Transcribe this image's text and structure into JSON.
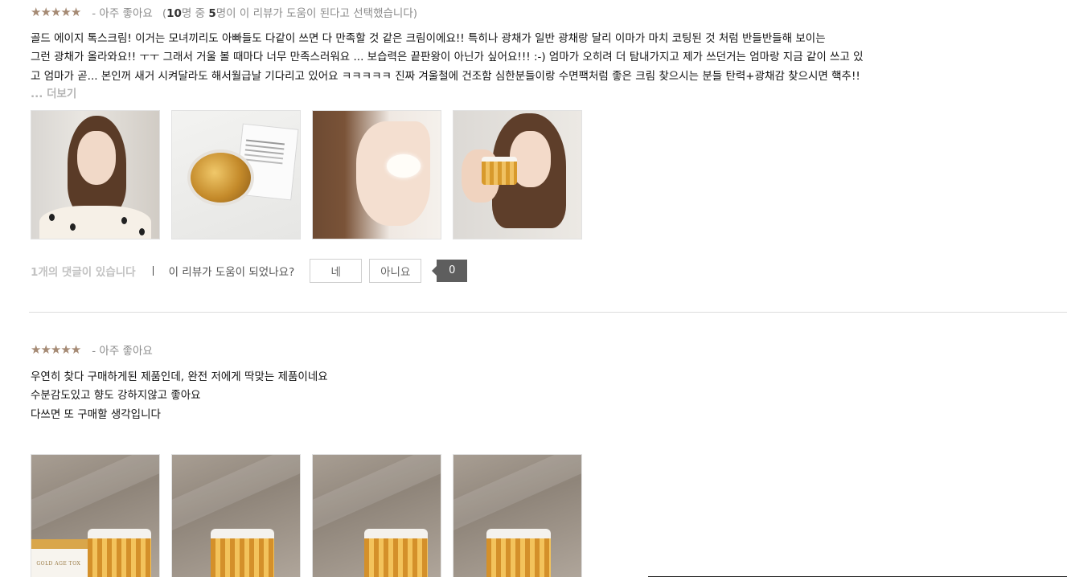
{
  "reviews": [
    {
      "rating": 5,
      "rating_label": "- 아주 좋아요",
      "helpful_summary": {
        "prefix": "(",
        "total": "10",
        "mid1": "명 중 ",
        "helpful": "5",
        "suffix": "명이 이 리뷰가 도움이 된다고 선택했습니다)"
      },
      "body_lines": [
        "골드 에이지 톡스크림! 이거는 모녀끼리도 아빠들도 다같이 쓰면 다 만족할 것 같은 크림이에요!! 특히나 광채가 일반 광채랑 달리 이마가 마치 코팅된 것 처럼 반들반들해 보이는",
        "그런 광채가 올라와요!! ㅜㅜ 그래서 거울 볼 때마다 너무 만족스러워요 ... 보습력은 끝판왕이 아닌가 싶어요!!! :-) 엄마가 오히려 더 탐내가지고 제가 쓰던거는 엄마랑 지금 같이 쓰고 있",
        "고 엄마가 곧... 본인꺼 새거 시켜달라도 해서월급날 기다리고 있어요 ㅋㅋㅋㅋㅋ 진짜 겨울철에 건조함 심한분들이랑 수면팩처럼 좋은 크림 찾으시는 분들 탄력+광채감 찾으시면 핵추!!"
      ],
      "more_label": "... 더보기",
      "comment_count_label": "1개의 댓글이 있습니다",
      "helpful_question": "이 리뷰가 도움이 되었나요?",
      "yes_label": "네",
      "no_label": "아니요",
      "helpful_count": "0"
    },
    {
      "rating": 5,
      "rating_label": "- 아주 좋아요",
      "body_lines": [
        "우연히 찾다 구매하게된 제품인데, 완전 저에게 딱맞는 제품이네요",
        "수분감도있고 향도 강하지않고 좋아요",
        "다쓰면 또 구매할 생각입니다"
      ],
      "product_text": "GOLD AGE TOX"
    }
  ],
  "colors": {
    "star": "#a58a74",
    "badge": "#5e5e5e",
    "muted": "#8c8c8c"
  },
  "icons": {
    "star": "★"
  }
}
